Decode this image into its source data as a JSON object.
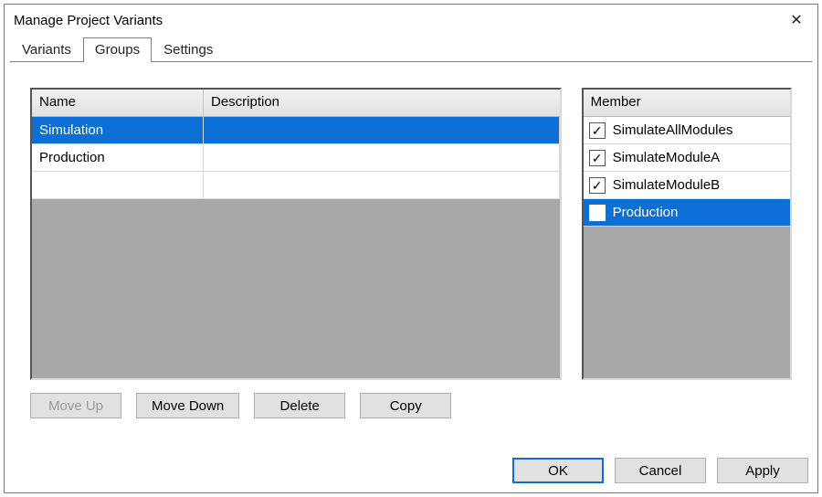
{
  "window": {
    "title": "Manage Project Variants"
  },
  "tabs": {
    "items": [
      {
        "label": "Variants",
        "active": false
      },
      {
        "label": "Groups",
        "active": true
      },
      {
        "label": "Settings",
        "active": false
      }
    ]
  },
  "groups_grid": {
    "headers": {
      "name": "Name",
      "description": "Description"
    },
    "rows": [
      {
        "name": "Simulation",
        "description": "",
        "selected": true
      },
      {
        "name": "Production",
        "description": "",
        "selected": false
      },
      {
        "name": "",
        "description": "",
        "selected": false,
        "empty": true
      }
    ]
  },
  "members_grid": {
    "header": "Member",
    "rows": [
      {
        "label": "SimulateAllModules",
        "checked": true,
        "selected": false
      },
      {
        "label": "SimulateModuleA",
        "checked": true,
        "selected": false
      },
      {
        "label": "SimulateModuleB",
        "checked": true,
        "selected": false
      },
      {
        "label": "Production",
        "checked": false,
        "selected": true
      }
    ]
  },
  "action_buttons": {
    "move_up": {
      "label": "Move Up",
      "enabled": false
    },
    "move_down": {
      "label": "Move Down",
      "enabled": true
    },
    "delete": {
      "label": "Delete",
      "enabled": true
    },
    "copy": {
      "label": "Copy",
      "enabled": true
    }
  },
  "dialog_buttons": {
    "ok": "OK",
    "cancel": "Cancel",
    "apply": "Apply"
  },
  "glyphs": {
    "check": "✓",
    "close": "✕"
  }
}
